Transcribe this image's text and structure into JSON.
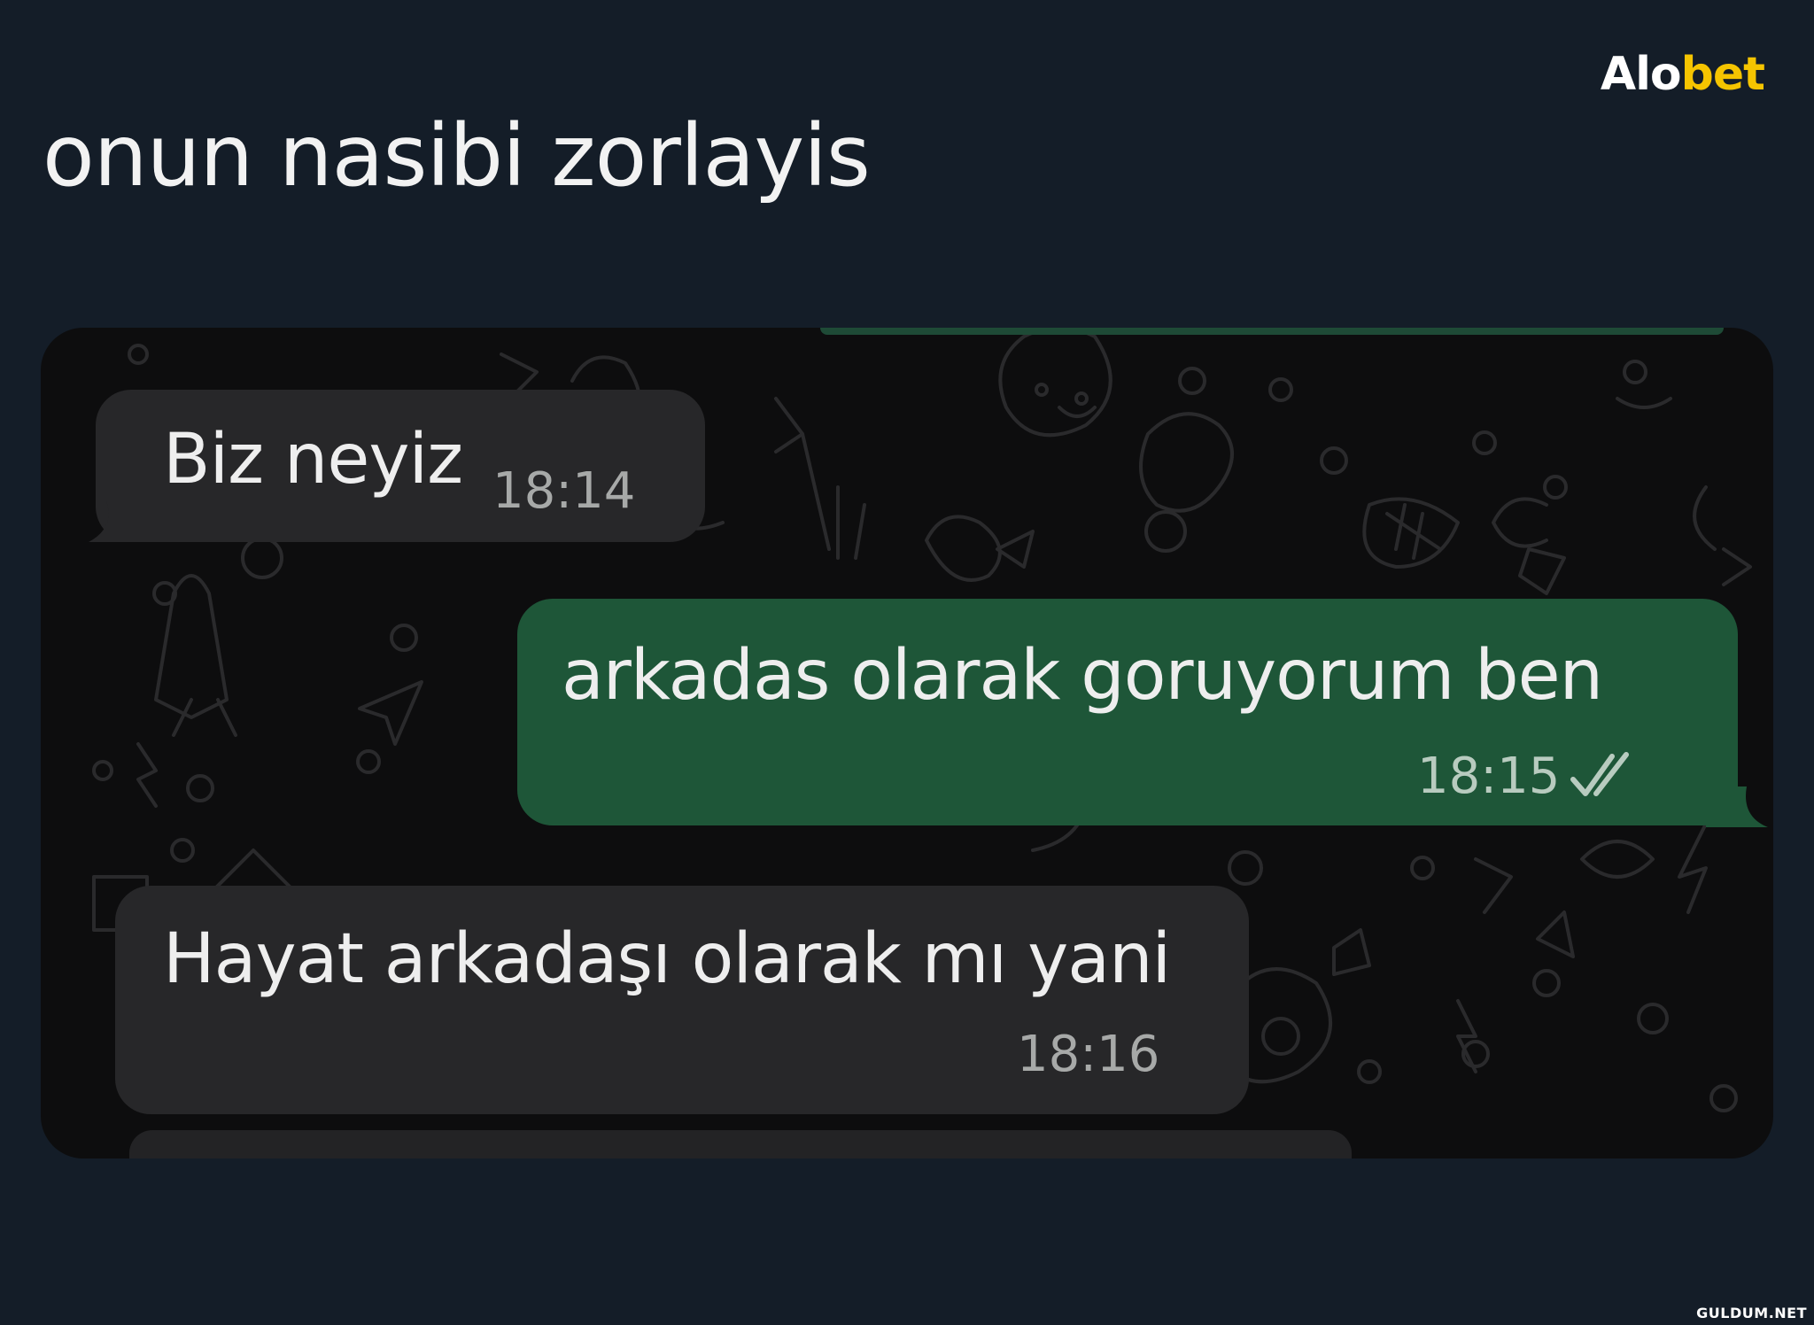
{
  "brand": {
    "part1": "Al",
    "part2": "o",
    "part3": "bet"
  },
  "post": {
    "caption": "onun nasibi zorlayis"
  },
  "chat": {
    "messages": [
      {
        "direction": "incoming",
        "text": "Biz neyiz",
        "time": "18:14"
      },
      {
        "direction": "outgoing",
        "text": "arkadas olarak goruyorum ben",
        "time": "18:15",
        "status_icon": "double-check-icon"
      },
      {
        "direction": "incoming",
        "text": "Hayat arkadaşı olarak mı yani",
        "time": "18:16"
      }
    ]
  },
  "watermark": "GULDUM.NET",
  "colors": {
    "background": "#141d28",
    "incoming_bubble": "#272729",
    "outgoing_bubble": "#1e5638",
    "brand_yellow": "#f5c400"
  }
}
